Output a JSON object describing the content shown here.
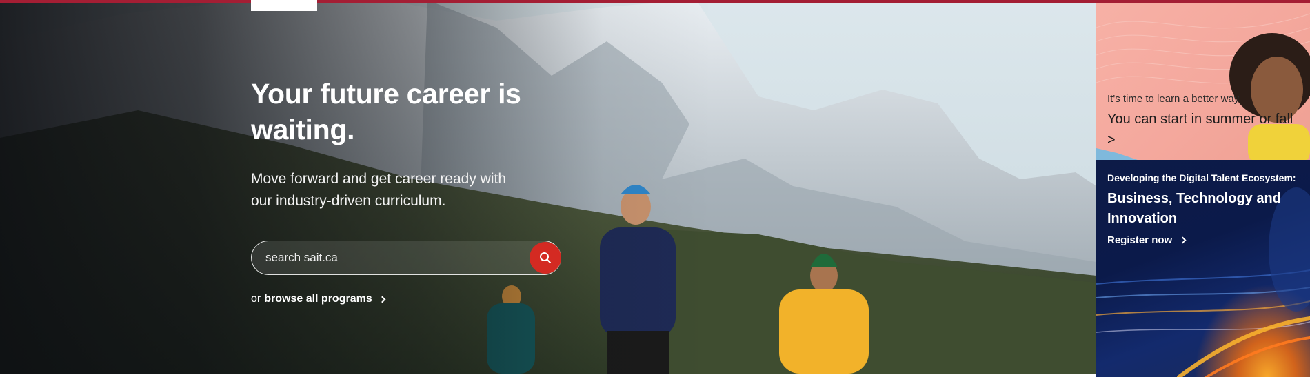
{
  "hero": {
    "title": "Your future career is waiting.",
    "subtitle": "Move forward and get career ready with our industry-driven curriculum.",
    "search": {
      "placeholder": "search sait.ca",
      "icon": "search-icon"
    },
    "browse": {
      "prefix": "or",
      "link_label": "browse all programs",
      "icon": "chevron-right-icon"
    }
  },
  "promos": [
    {
      "kicker": "It's time to learn a better way",
      "headline": "You can start in summer or fall >"
    },
    {
      "kicker": "Developing the Digital Talent Ecosystem:",
      "headline": "Business, Technology and Innovation",
      "cta": "Register now",
      "icon": "chevron-right-icon"
    }
  ],
  "colors": {
    "brand_red": "#a41e34",
    "search_button": "#d42a22",
    "promo1_bg": "#f4a89d",
    "promo2_bg": "#0b1a4a"
  }
}
